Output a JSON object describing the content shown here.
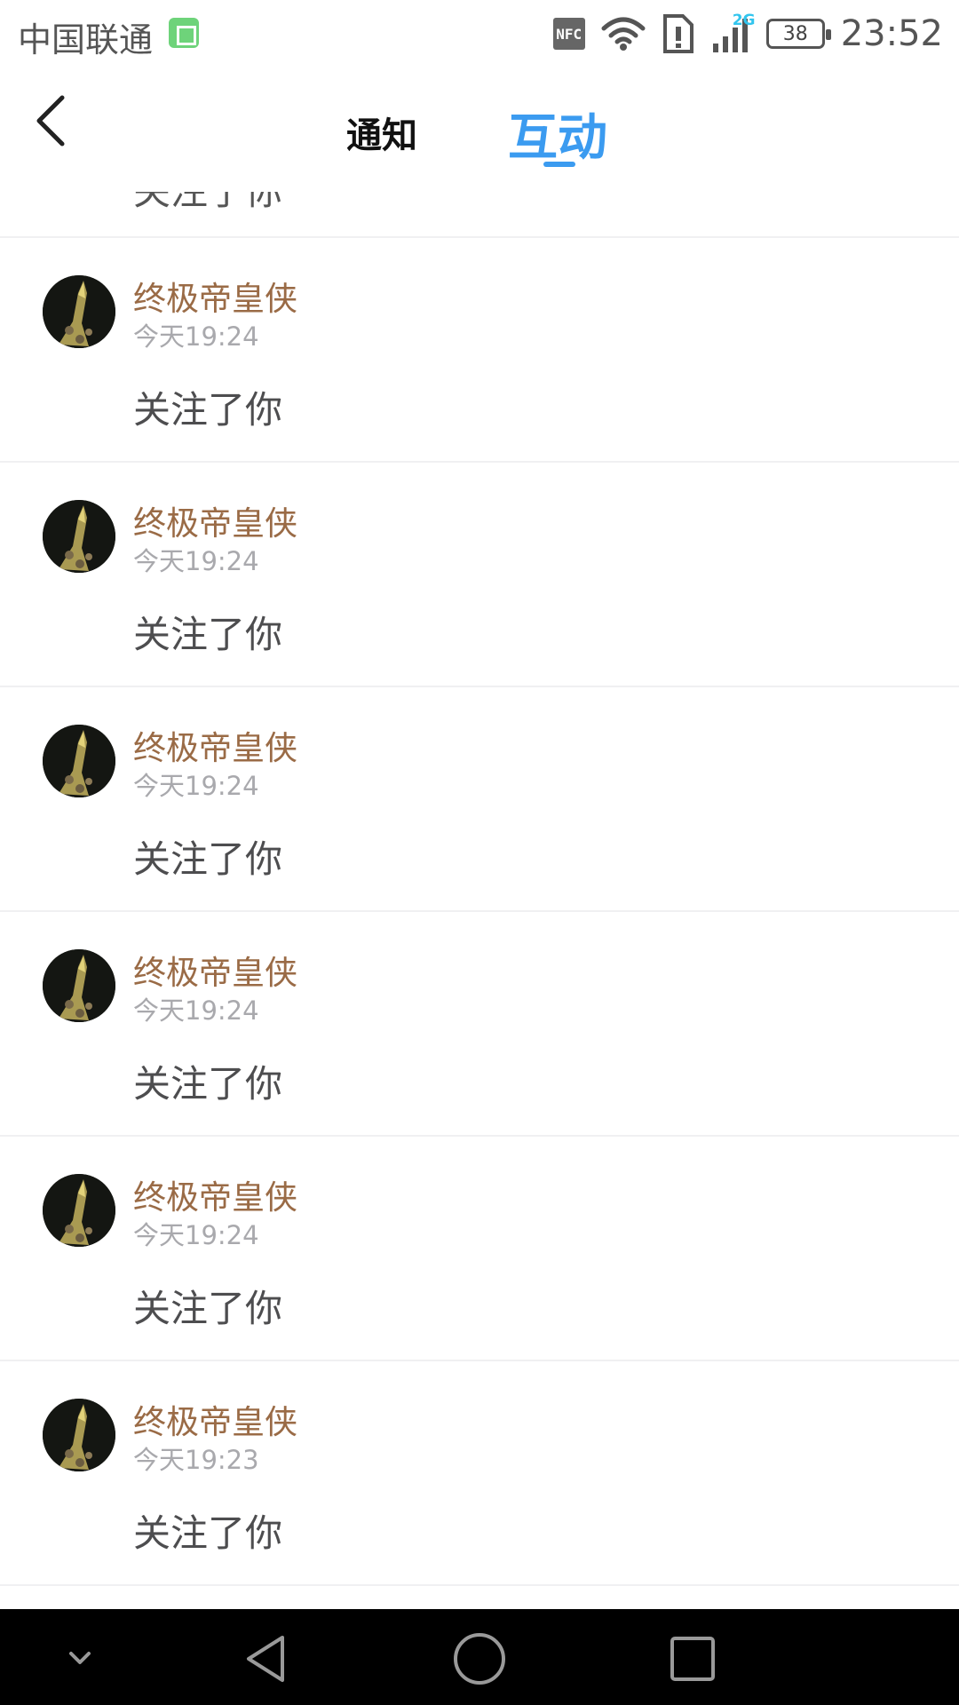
{
  "status_bar": {
    "carrier": "中国联通",
    "nfc": "NFC",
    "network": "2G",
    "battery": "38",
    "time": "23:52"
  },
  "header": {
    "tabs": [
      {
        "label": "通知",
        "active": false
      },
      {
        "label": "互动",
        "active": true
      }
    ],
    "active_color": "#3b9bf0"
  },
  "partial_item": {
    "action": "关注了你"
  },
  "items": [
    {
      "name": "终极帝皇侠",
      "time": "今天19:24",
      "action": "关注了你"
    },
    {
      "name": "终极帝皇侠",
      "time": "今天19:24",
      "action": "关注了你"
    },
    {
      "name": "终极帝皇侠",
      "time": "今天19:24",
      "action": "关注了你"
    },
    {
      "name": "终极帝皇侠",
      "time": "今天19:24",
      "action": "关注了你"
    },
    {
      "name": "终极帝皇侠",
      "time": "今天19:24",
      "action": "关注了你"
    },
    {
      "name": "终极帝皇侠",
      "time": "今天19:23",
      "action": "关注了你"
    }
  ],
  "nav": {
    "icons": [
      "chevron-down-icon",
      "back-triangle-icon",
      "home-circle-icon",
      "recents-square-icon"
    ]
  }
}
